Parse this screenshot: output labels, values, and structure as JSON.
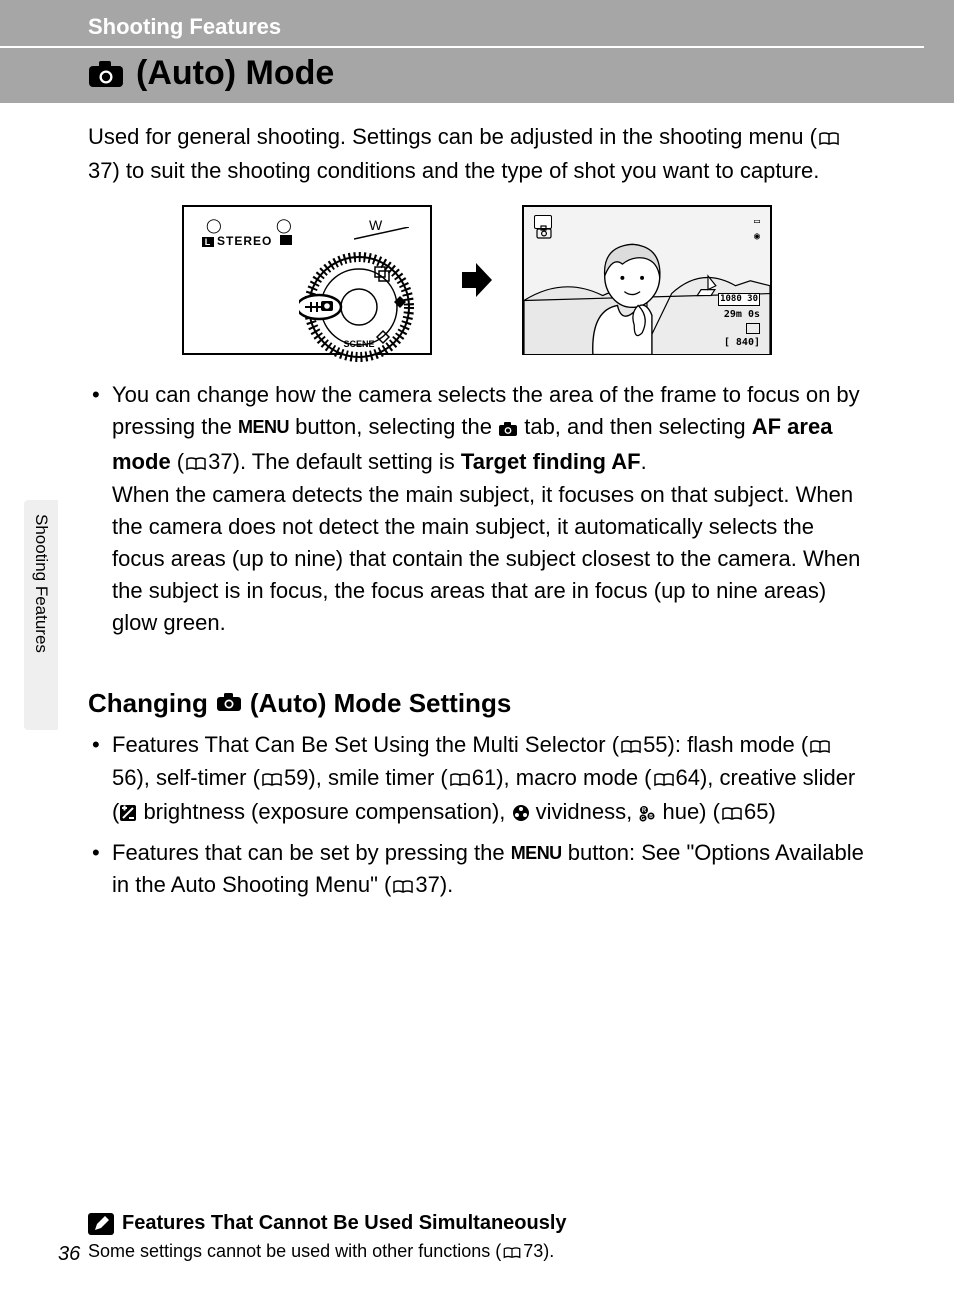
{
  "header": {
    "section": "Shooting Features",
    "title_prefix_icon": "camera-icon",
    "title": "(Auto) Mode"
  },
  "intro": {
    "text_a": "Used for general shooting. Settings can be adjusted in the shooting menu (",
    "ref1": "37",
    "text_b": ") to suit the shooting conditions and the type of shot you want to capture."
  },
  "figure": {
    "stereo_label": "STEREO",
    "w_label": "W",
    "lcd": {
      "res": "1080 30",
      "time": "29m 0s",
      "count": "[ 840]"
    }
  },
  "bullet1": {
    "a": "You can change how the camera selects the area of the frame to focus on by pressing the ",
    "menu": "MENU",
    "b": " button, selecting the ",
    "c": " tab, and then selecting ",
    "af_area": "AF area mode",
    "d": " (",
    "ref": "37",
    "e": "). The default setting is ",
    "target": "Target finding AF",
    "f": ".",
    "para2": "When the camera detects the main subject, it focuses on that subject. When the camera does not detect the main subject, it automatically selects the focus areas (up to nine) that contain the subject closest to the camera. When the subject is in focus, the focus areas that are in focus (up to nine areas) glow green."
  },
  "subhead": {
    "a": "Changing ",
    "b": " (Auto) Mode Settings"
  },
  "bullets2": {
    "item1": {
      "a": "Features That Can Be Set Using the Multi Selector (",
      "r1": "55",
      "b": "): flash mode (",
      "r2": "56",
      "c": "), self-timer (",
      "r3": "59",
      "d": "), smile timer (",
      "r4": "61",
      "e": "), macro mode (",
      "r5": "64",
      "f": "), creative slider (",
      "g": " brightness (exposure compensation), ",
      "h": " vividness, ",
      "i": " hue) (",
      "r6": "65",
      "j": ")"
    },
    "item2": {
      "a": "Features that can be set by pressing the ",
      "menu": "MENU",
      "b": " button: See \"Options Available in the Auto Shooting Menu\" (",
      "r1": "37",
      "c": ")."
    }
  },
  "sidebar": "Shooting Features",
  "note": {
    "title": "Features That Cannot Be Used Simultaneously",
    "body_a": "Some settings cannot be used with other functions (",
    "ref": "73",
    "body_b": ")."
  },
  "page_number": "36"
}
